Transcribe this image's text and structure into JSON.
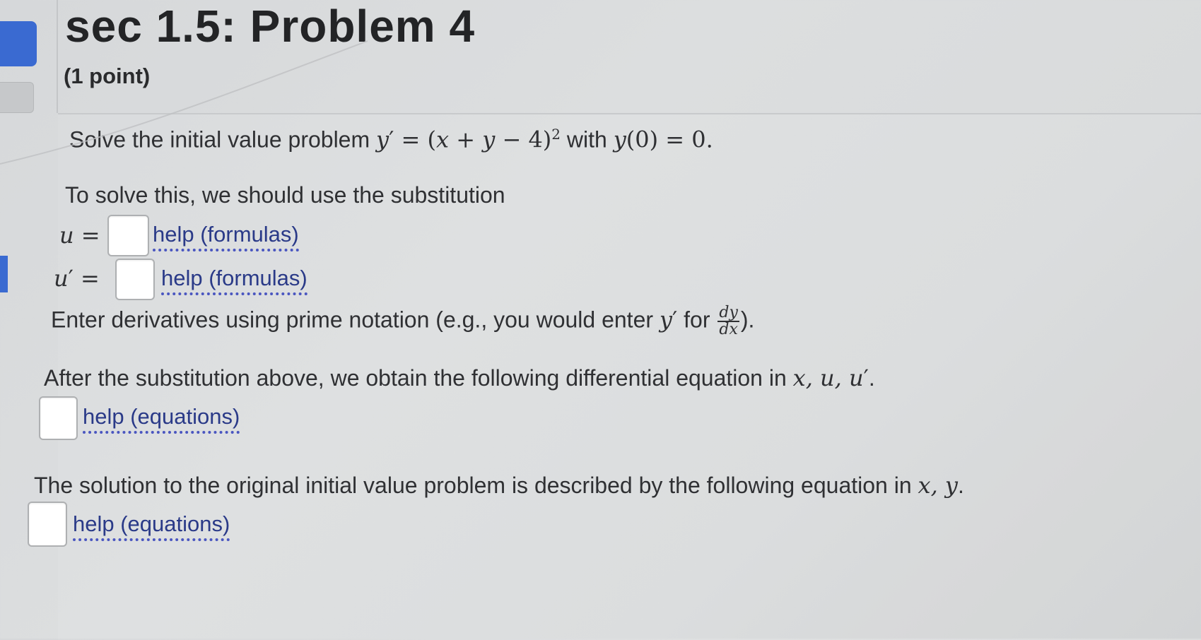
{
  "header": {
    "title": "sec 1.5: Problem 4",
    "points": "(1 point)"
  },
  "problem": {
    "statement_prefix": "Solve the initial value problem ",
    "ode_lhs": "y",
    "prime": "′",
    "ode_eq": " = (",
    "ode_x": "x",
    "ode_plus": " + ",
    "ode_y": "y",
    "ode_minus": " − 4)",
    "ode_exp": "2",
    "with": " with ",
    "ic_y": "y",
    "ic_rest": "(0) = 0.",
    "substitution_intro": "To solve this, we should use the substitution",
    "u_label": "u",
    "eq_sign": " = ",
    "uprime_label": "u",
    "help_formulas": "help (formulas)",
    "derivative_note_prefix": "Enter derivatives using prime notation (e.g., you would enter ",
    "derivative_note_y": "y",
    "derivative_note_for": " for ",
    "frac_num": "dy",
    "frac_den": "dx",
    "derivative_note_suffix": ").",
    "after_sub_prefix": "After the substitution above, we obtain the following differential equation in ",
    "after_sub_vars": "x, u, u",
    "after_sub_suffix": ".",
    "help_equations": "help (equations)",
    "solution_prefix": "The solution to the original initial value problem is described by the following equation in ",
    "solution_vars": "x, y",
    "solution_suffix": "."
  },
  "answers": {
    "u_value": "",
    "uprime_value": "",
    "ode_value": "",
    "solution_value": ""
  },
  "colors": {
    "accent_blue": "#3a6ad1",
    "link": "#2a3a88"
  }
}
